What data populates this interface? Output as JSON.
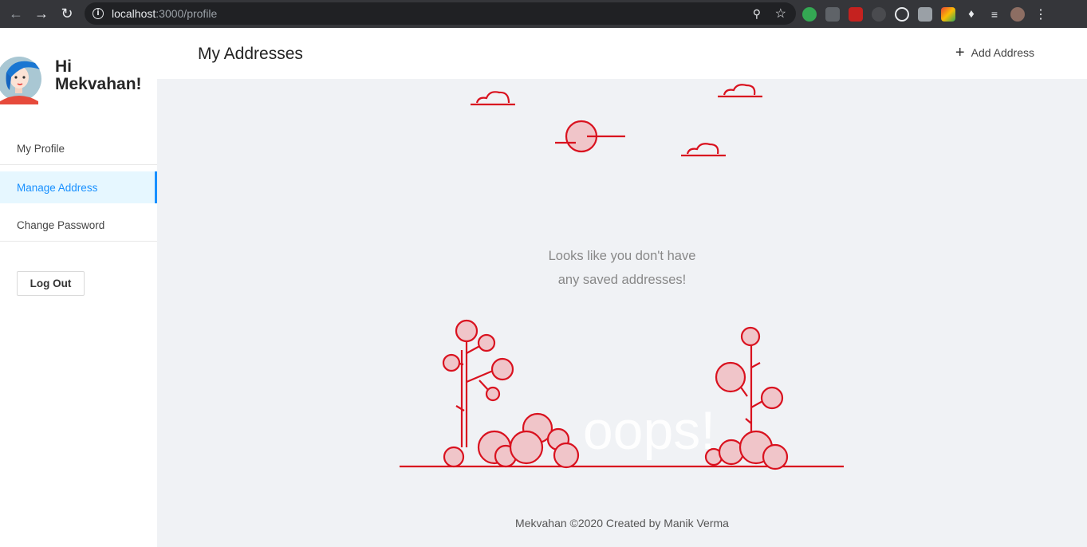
{
  "browser": {
    "url_host": "localhost",
    "url_path": ":3000/profile",
    "info_glyph": "i"
  },
  "sidebar": {
    "greeting_line1": "Hi",
    "greeting_line2": "Mekvahan!",
    "items": [
      {
        "label": "My Profile",
        "active": false
      },
      {
        "label": "Manage Address",
        "active": true
      },
      {
        "label": "Change Password",
        "active": false
      }
    ],
    "logout_label": "Log Out"
  },
  "header": {
    "title": "My Addresses",
    "add_label": "Add Address",
    "add_icon": "plus-icon"
  },
  "empty_state": {
    "line1": "Looks like you don't have",
    "line2": "any saved addresses!",
    "illustration_text": "oops!"
  },
  "footer": {
    "text": "Mekvahan ©2020 Created by Manik Verma"
  },
  "colors": {
    "accent": "#1890ff",
    "illustration": "#d9121f",
    "illustration_fill": "#f0c5c9"
  }
}
